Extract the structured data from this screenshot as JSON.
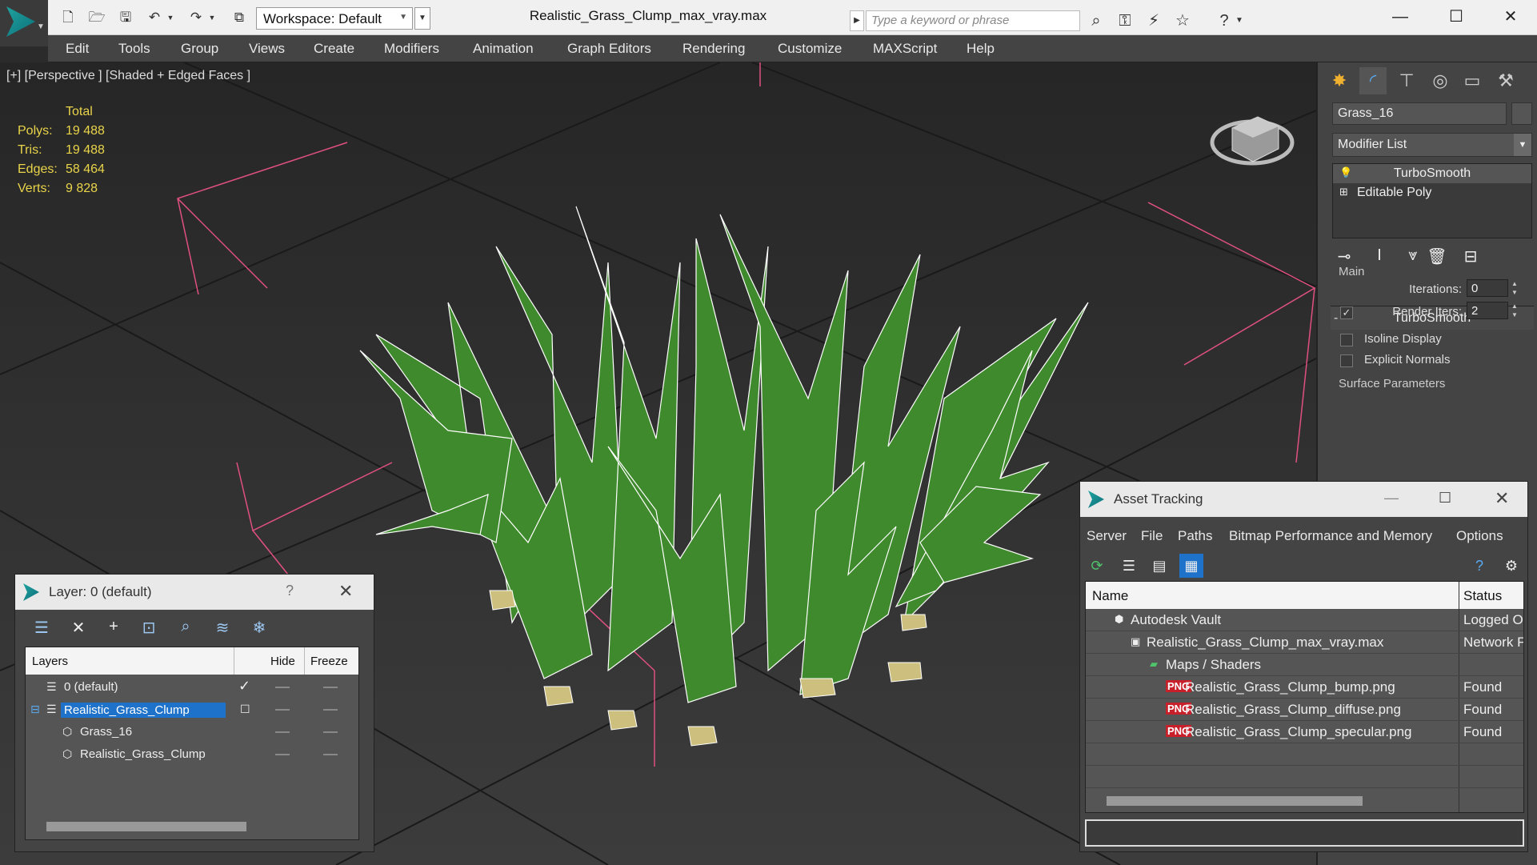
{
  "titlebar": {
    "workspace": "Workspace: Default",
    "doc_title": "Realistic_Grass_Clump_max_vray.max",
    "search_placeholder": "Type a keyword or phrase"
  },
  "menu": [
    "Edit",
    "Tools",
    "Group",
    "Views",
    "Create",
    "Modifiers",
    "Animation",
    "Graph Editors",
    "Rendering",
    "Customize",
    "MAXScript",
    "Help"
  ],
  "viewport": {
    "label": "[+] [Perspective ] [Shaded + Edged Faces ]",
    "stats": {
      "header": "Total",
      "rows": [
        {
          "k": "Polys:",
          "v": "19 488"
        },
        {
          "k": "Tris:",
          "v": "19 488"
        },
        {
          "k": "Edges:",
          "v": "58 464"
        },
        {
          "k": "Verts:",
          "v": "9 828"
        }
      ]
    },
    "colors": {
      "grass": "#3f8a2c",
      "edge": "#ffffff",
      "grid": "#1a1a1a",
      "helper": "#e05080",
      "stats": "#e9d44a"
    }
  },
  "command_panel": {
    "object_name": "Grass_16",
    "modifier_list": "Modifier List",
    "stack": [
      "TurboSmooth",
      "Editable Poly"
    ],
    "rollout_title": "TurboSmooth",
    "main_group": "Main",
    "iterations_label": "Iterations:",
    "iterations_value": "0",
    "render_iters_label": "Render Iters:",
    "render_iters_value": "2",
    "isoline_label": "Isoline Display",
    "explicit_normals_label": "Explicit Normals",
    "surface_params": "Surface Parameters"
  },
  "layer_dialog": {
    "title": "Layer: 0 (default)",
    "help": "?",
    "columns": [
      "Layers",
      "Hide",
      "Freeze"
    ],
    "rows": [
      {
        "name": "0 (default)"
      },
      {
        "name": "Realistic_Grass_Clump"
      },
      {
        "name": "Grass_16"
      },
      {
        "name": "Realistic_Grass_Clump"
      }
    ]
  },
  "asset_dialog": {
    "title": "Asset Tracking",
    "menu": [
      "Server",
      "File",
      "Paths",
      "Bitmap Performance and Memory",
      "Options"
    ],
    "columns": [
      "Name",
      "Status"
    ],
    "rows": [
      {
        "name": "Autodesk Vault",
        "status": "Logged O"
      },
      {
        "name": "Realistic_Grass_Clump_max_vray.max",
        "status": "Network F"
      },
      {
        "name": "Maps / Shaders",
        "status": ""
      },
      {
        "name": "Realistic_Grass_Clump_bump.png",
        "status": "Found"
      },
      {
        "name": "Realistic_Grass_Clump_diffuse.png",
        "status": "Found"
      },
      {
        "name": "Realistic_Grass_Clump_specular.png",
        "status": "Found"
      }
    ],
    "png_badge": "PNG"
  }
}
